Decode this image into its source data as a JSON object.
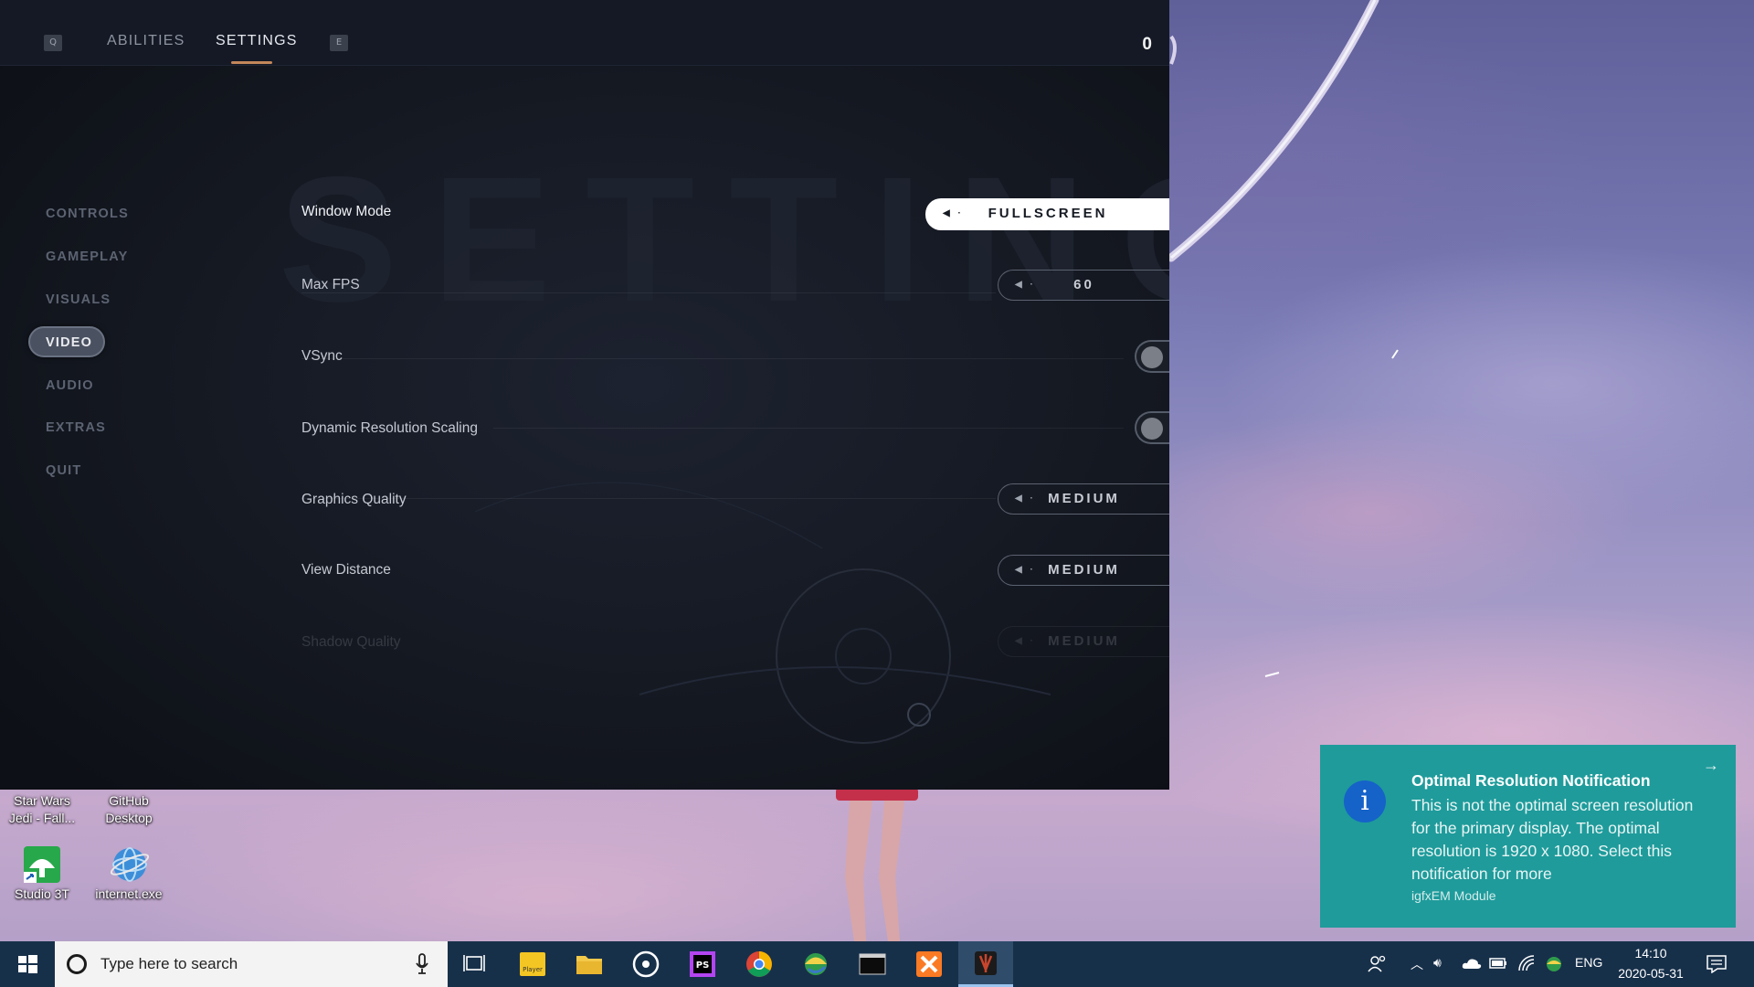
{
  "game": {
    "key_left": "Q",
    "key_right": "E",
    "tabs": [
      {
        "label": "ABILITIES",
        "active": false
      },
      {
        "label": "SETTINGS",
        "active": true
      }
    ],
    "skill_points": "0",
    "background_word": "SETTINGS",
    "sidebar": [
      "CONTROLS",
      "GAMEPLAY",
      "VISUALS",
      "VIDEO",
      "AUDIO",
      "EXTRAS",
      "QUIT"
    ],
    "active_sidebar": "VIDEO",
    "settings": {
      "window_mode": {
        "label": "Window Mode",
        "value": "FULLSCREEN"
      },
      "max_fps": {
        "label": "Max FPS",
        "value": "60"
      },
      "vsync": {
        "label": "VSync",
        "on": false
      },
      "dynamic_resolution": {
        "label": "Dynamic Resolution Scaling",
        "on": false
      },
      "graphics_quality": {
        "label": "Graphics Quality",
        "value": "MEDIUM"
      },
      "view_distance": {
        "label": "View Distance",
        "value": "MEDIUM"
      },
      "shadow_quality": {
        "label": "Shadow Quality",
        "value": "MEDIUM"
      }
    },
    "accent_color": "#c3875a"
  },
  "desktop": {
    "icons": [
      {
        "label": "Star Wars Jedi - Fall...",
        "icon": "star-wars-jedi-icon"
      },
      {
        "label": "GitHub Desktop",
        "icon": "github-desktop-icon"
      },
      {
        "label": "Studio 3T",
        "icon": "studio-3t-icon"
      },
      {
        "label": "internet.exe",
        "icon": "internet-globe-icon"
      }
    ]
  },
  "notification": {
    "title": "Optimal Resolution Notification",
    "body": "This is not the optimal screen resolution for the primary display. The optimal resolution is 1920 x 1080. Select this notification for more",
    "source": "igfxEM Module",
    "color": "#1f9b9b"
  },
  "taskbar": {
    "search_placeholder": "Type here to search",
    "apps": [
      "task-view-icon",
      "player-icon",
      "file-explorer-icon",
      "media-icon",
      "phpstorm-icon",
      "chrome-icon",
      "globe-app-icon",
      "terminal-icon",
      "xampp-icon",
      "jedi-game-icon"
    ],
    "active_app": "jedi-game-icon",
    "language": "ENG",
    "time": "14:10",
    "date": "2020-05-31"
  }
}
